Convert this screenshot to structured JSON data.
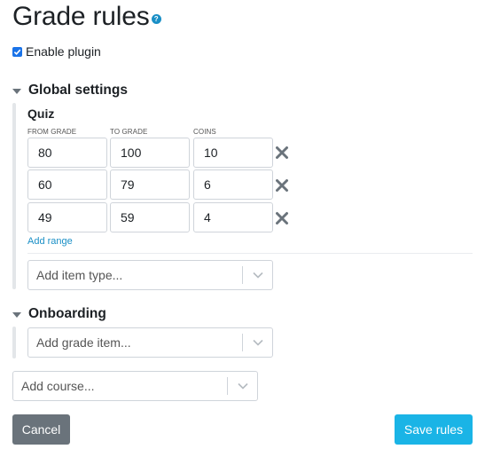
{
  "page": {
    "title": "Grade rules",
    "help_icon": "question-circle-icon",
    "enable_plugin_label": "Enable plugin",
    "enable_plugin_checked": true
  },
  "global_settings": {
    "heading": "Global settings",
    "quiz": {
      "label": "Quiz",
      "columns": [
        "FROM GRADE",
        "TO GRADE",
        "COINS"
      ],
      "rows": [
        {
          "from": "80",
          "to": "100",
          "coins": "10"
        },
        {
          "from": "60",
          "to": "79",
          "coins": "6"
        },
        {
          "from": "49",
          "to": "59",
          "coins": "4"
        }
      ],
      "add_range_label": "Add range"
    },
    "add_item_type_placeholder": "Add item type..."
  },
  "onboarding": {
    "heading": "Onboarding",
    "add_grade_item_placeholder": "Add grade item..."
  },
  "add_course_placeholder": "Add course...",
  "actions": {
    "cancel_label": "Cancel",
    "save_label": "Save rules"
  },
  "colors": {
    "accent": "#1ab4e6",
    "link": "#1a8fc6",
    "cancel_bg": "#6a737b",
    "remove_icon": "#6a737b"
  }
}
